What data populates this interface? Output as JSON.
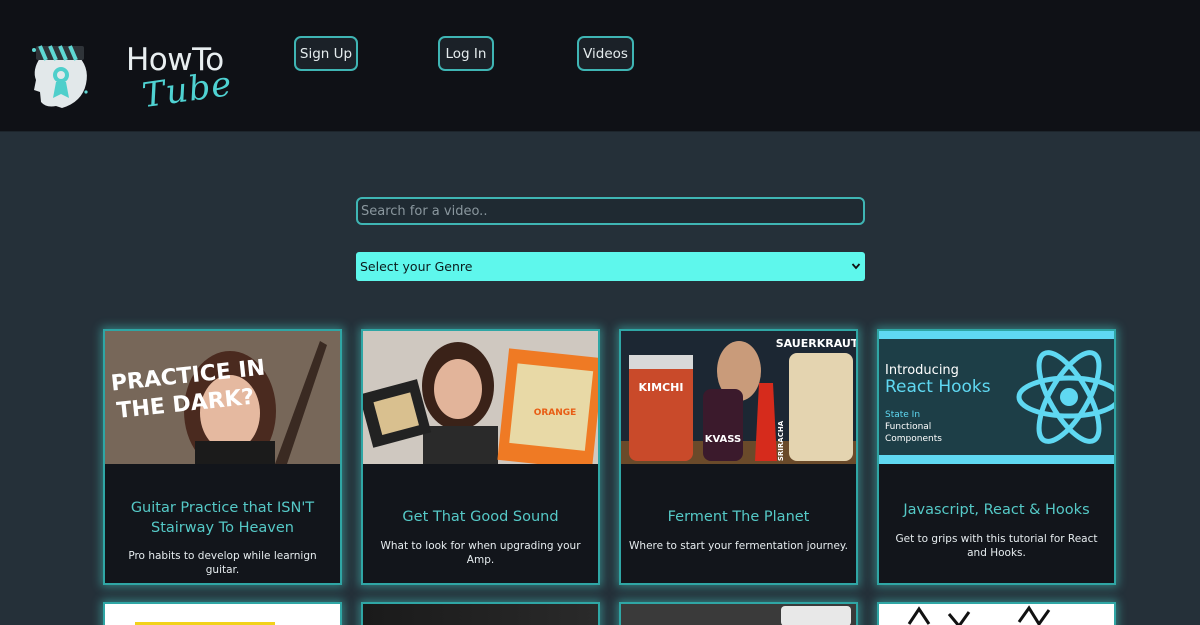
{
  "brand": {
    "how": "HowTo",
    "tube": "Tube"
  },
  "nav": {
    "signup": "Sign Up",
    "login": "Log In",
    "videos": "Videos"
  },
  "search": {
    "placeholder": "Search for a video.."
  },
  "genre": {
    "selected": "Select your Genre"
  },
  "cards": [
    {
      "title": "Guitar Practice that ISN'T Stairway To Heaven",
      "desc": "Pro habits to develop while learnign guitar.",
      "thumb_text": [
        "PRACTICE IN",
        "THE DARK?"
      ]
    },
    {
      "title": "Get That Good Sound",
      "desc": "What to look for when upgrading your Amp.",
      "thumb_text": [
        "ORANGE"
      ]
    },
    {
      "title": "Ferment The Planet",
      "desc": "Where to start your fermentation journey.",
      "thumb_text": [
        "KIMCHI",
        "KVASS",
        "SRIRACHA",
        "SAUERKRAUT"
      ]
    },
    {
      "title": "Javascript, React & Hooks",
      "desc": "Get to grips with this tutorial for React and Hooks.",
      "thumb_text": [
        "Introducing",
        "React Hooks",
        "State In",
        "Functional",
        "Components"
      ]
    }
  ],
  "colors": {
    "accent": "#3fb5b4",
    "genre_bg": "#5ef7ec",
    "header_bg": "#0f1116",
    "page_bg": "#253039"
  },
  "icons": [
    "film-head-logo-icon",
    "chevron-down-icon"
  ]
}
